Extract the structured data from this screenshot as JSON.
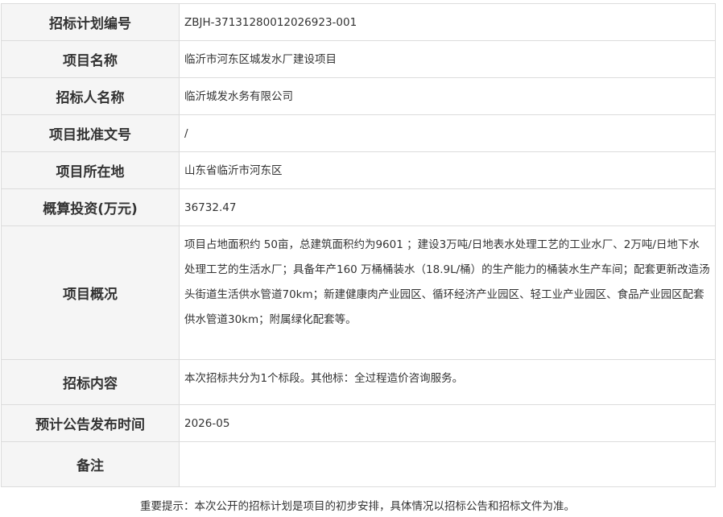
{
  "rows": [
    {
      "label": "招标计划编号",
      "value": "ZBJH-37131280012026923-001"
    },
    {
      "label": "项目名称",
      "value": "临沂市河东区城发水厂建设项目"
    },
    {
      "label": "招标人名称",
      "value": "临沂城发水务有限公司"
    },
    {
      "label": "项目批准文号",
      "value": "/"
    },
    {
      "label": "项目所在地",
      "value": "山东省临沂市河东区"
    },
    {
      "label": "概算投资(万元)",
      "value": "36732.47"
    },
    {
      "label": "项目概况",
      "value": "项目占地面积约 50亩，总建筑面积约为9601 ；建设3万吨/日地表水处理工艺的工业水厂、2万吨/日地下水处理工艺的生活水厂；具备年产160 万桶桶装水（18.9L/桶）的生产能力的桶装水生产车间；配套更新改造汤头街道生活供水管道70km；新建健康肉产业园区、循环经济产业园区、轻工业产业园区、食品产业园区配套供水管道30km；附属绿化配套等。"
    },
    {
      "label": "招标内容",
      "value": "本次招标共分为1个标段。其他标：全过程造价咨询服务。"
    },
    {
      "label": "预计公告发布时间",
      "value": "2026-05"
    },
    {
      "label": "备注",
      "value": ""
    }
  ],
  "footer": {
    "note": "重要提示：本次公开的招标计划是项目的初步安排，具体情况以招标公告和招标文件为准。"
  }
}
